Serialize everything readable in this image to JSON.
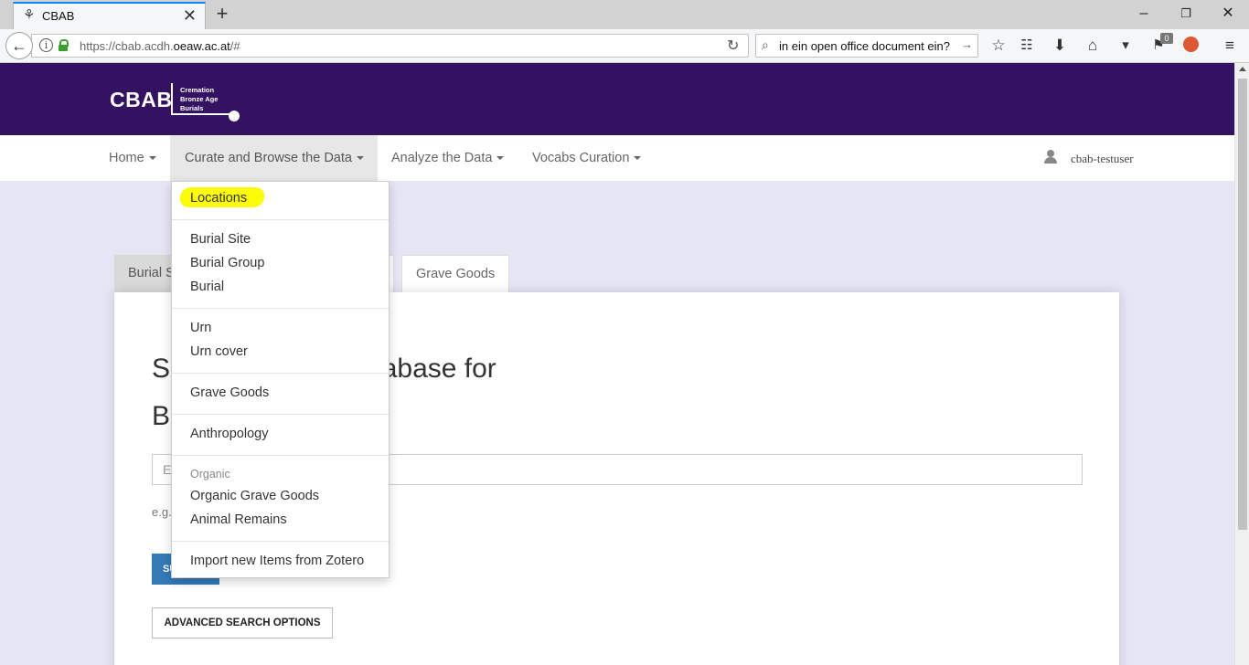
{
  "browser": {
    "tab_title": "CBAB",
    "url_prefix": "https://cbab.acdh.",
    "url_domain": "oeaw.ac.at",
    "url_suffix": "/#",
    "search_text": "in ein open office document ein?",
    "notification_count": "0"
  },
  "site": {
    "logo_text": "CBAB",
    "logo_line1": "Cremation",
    "logo_line2": "Bronze Age",
    "logo_line3": "Burials",
    "brand_color": "#341262"
  },
  "nav": {
    "home": "Home",
    "curate": "Curate and Browse the Data",
    "analyze": "Analyze the Data",
    "vocabs": "Vocabs Curation",
    "user": "cbab-testuser"
  },
  "dropdown": {
    "highlight_color": "#fbfb0a",
    "locations": "Locations",
    "burial_site": "Burial Site",
    "burial_group": "Burial Group",
    "burial": "Burial",
    "urn": "Urn",
    "urn_cover": "Urn cover",
    "grave_goods": "Grave Goods",
    "anthropology": "Anthropology",
    "organic_header": "Organic",
    "organic_grave_goods": "Organic Grave Goods",
    "animal_remains": "Animal Remains",
    "import_zotero": "Import new Items from Zotero"
  },
  "page": {
    "tab_burial_site": "Burial S",
    "tab_grave_goods": "Grave Goods",
    "heading_line1_a": "Se",
    "heading_line1_b": "abase for",
    "heading_line2": "B",
    "search_placeholder": "E",
    "example_prefix": "e.g.",
    "submit_label": "SUBMIT",
    "advanced_label": "ADVANCED SEARCH OPTIONS"
  }
}
